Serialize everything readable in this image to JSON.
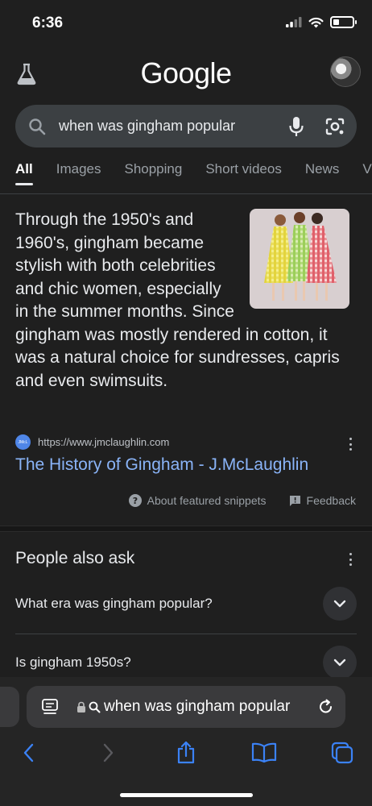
{
  "status_bar": {
    "time": "6:36",
    "battery_level": 0.3
  },
  "header": {
    "logo_text": "Google",
    "labs_icon": "flask-icon",
    "avatar_icon": "avatar"
  },
  "search": {
    "query": "when was gingham popular",
    "search_icon": "search-icon",
    "mic_icon": "mic-icon",
    "lens_icon": "camera-lens-icon"
  },
  "tabs": [
    {
      "label": "All",
      "active": true
    },
    {
      "label": "Images"
    },
    {
      "label": "Shopping"
    },
    {
      "label": "Short videos"
    },
    {
      "label": "News"
    },
    {
      "label": "V"
    }
  ],
  "featured_snippet": {
    "text": "Through the 1950's and 1960's, gingham became stylish with both celebrities and chic women, especially in the summer months. Since gingham was mostly rendered in cotton, it was a natural choice for sundresses, capris and even swimsuits.",
    "source_url": "https://www.jmclaughlin.com",
    "favicon_text": "JMcL",
    "link_title": "The History of Gingham - J.McLaughlin",
    "about_label": "About featured snippets",
    "feedback_label": "Feedback"
  },
  "people_also_ask": {
    "title": "People also ask",
    "questions": [
      "What era was gingham popular?",
      "Is gingham 1950s?"
    ]
  },
  "browser": {
    "address_text": "when was gingham popular"
  },
  "colors": {
    "link": "#8ab4f8",
    "background": "#1f1f1f",
    "searchbar": "#3c4043"
  }
}
